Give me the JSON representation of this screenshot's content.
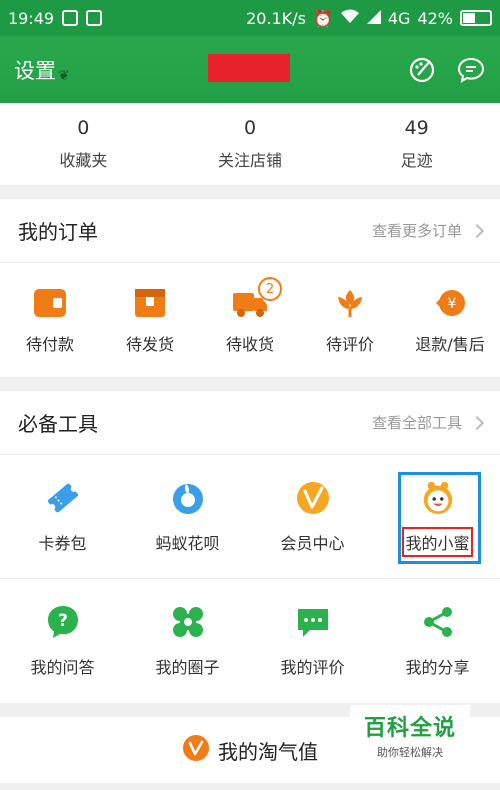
{
  "status_bar": {
    "time": "19:49",
    "net_speed": "20.1K/s",
    "network": "4G",
    "battery": "42%"
  },
  "header": {
    "title": "设置"
  },
  "stats": [
    {
      "value": "0",
      "label": "收藏夹"
    },
    {
      "value": "0",
      "label": "关注店铺"
    },
    {
      "value": "49",
      "label": "足迹"
    }
  ],
  "orders": {
    "title": "我的订单",
    "more": "查看更多订单",
    "items": [
      {
        "label": "待付款",
        "icon": "wallet-icon"
      },
      {
        "label": "待发货",
        "icon": "package-icon"
      },
      {
        "label": "待收货",
        "icon": "truck-icon",
        "badge": "2"
      },
      {
        "label": "待评价",
        "icon": "flower-icon"
      },
      {
        "label": "退款/售后",
        "icon": "refund-icon"
      }
    ]
  },
  "tools": {
    "title": "必备工具",
    "more": "查看全部工具",
    "row1": [
      {
        "label": "卡券包",
        "icon": "ticket-icon"
      },
      {
        "label": "蚂蚁花呗",
        "icon": "huabei-icon"
      },
      {
        "label": "会员中心",
        "icon": "vip-icon"
      },
      {
        "label": "我的小蜜",
        "icon": "assistant-face-icon"
      }
    ],
    "row2": [
      {
        "label": "我的问答",
        "icon": "question-icon"
      },
      {
        "label": "我的圈子",
        "icon": "circles-icon"
      },
      {
        "label": "我的评价",
        "icon": "comment-icon"
      },
      {
        "label": "我的分享",
        "icon": "share-icon"
      }
    ]
  },
  "taoqi": {
    "title": "我的淘气值"
  },
  "watermark": {
    "main": "百科全说",
    "sub": "助你轻松解决"
  },
  "colors": {
    "brand_green": "#23a047",
    "order_orange": "#f07c18",
    "tool_blue": "#3a9ee8",
    "tool_green": "#2bb24c",
    "highlight_blue": "#1b8ee8",
    "highlight_red": "#e62323"
  }
}
